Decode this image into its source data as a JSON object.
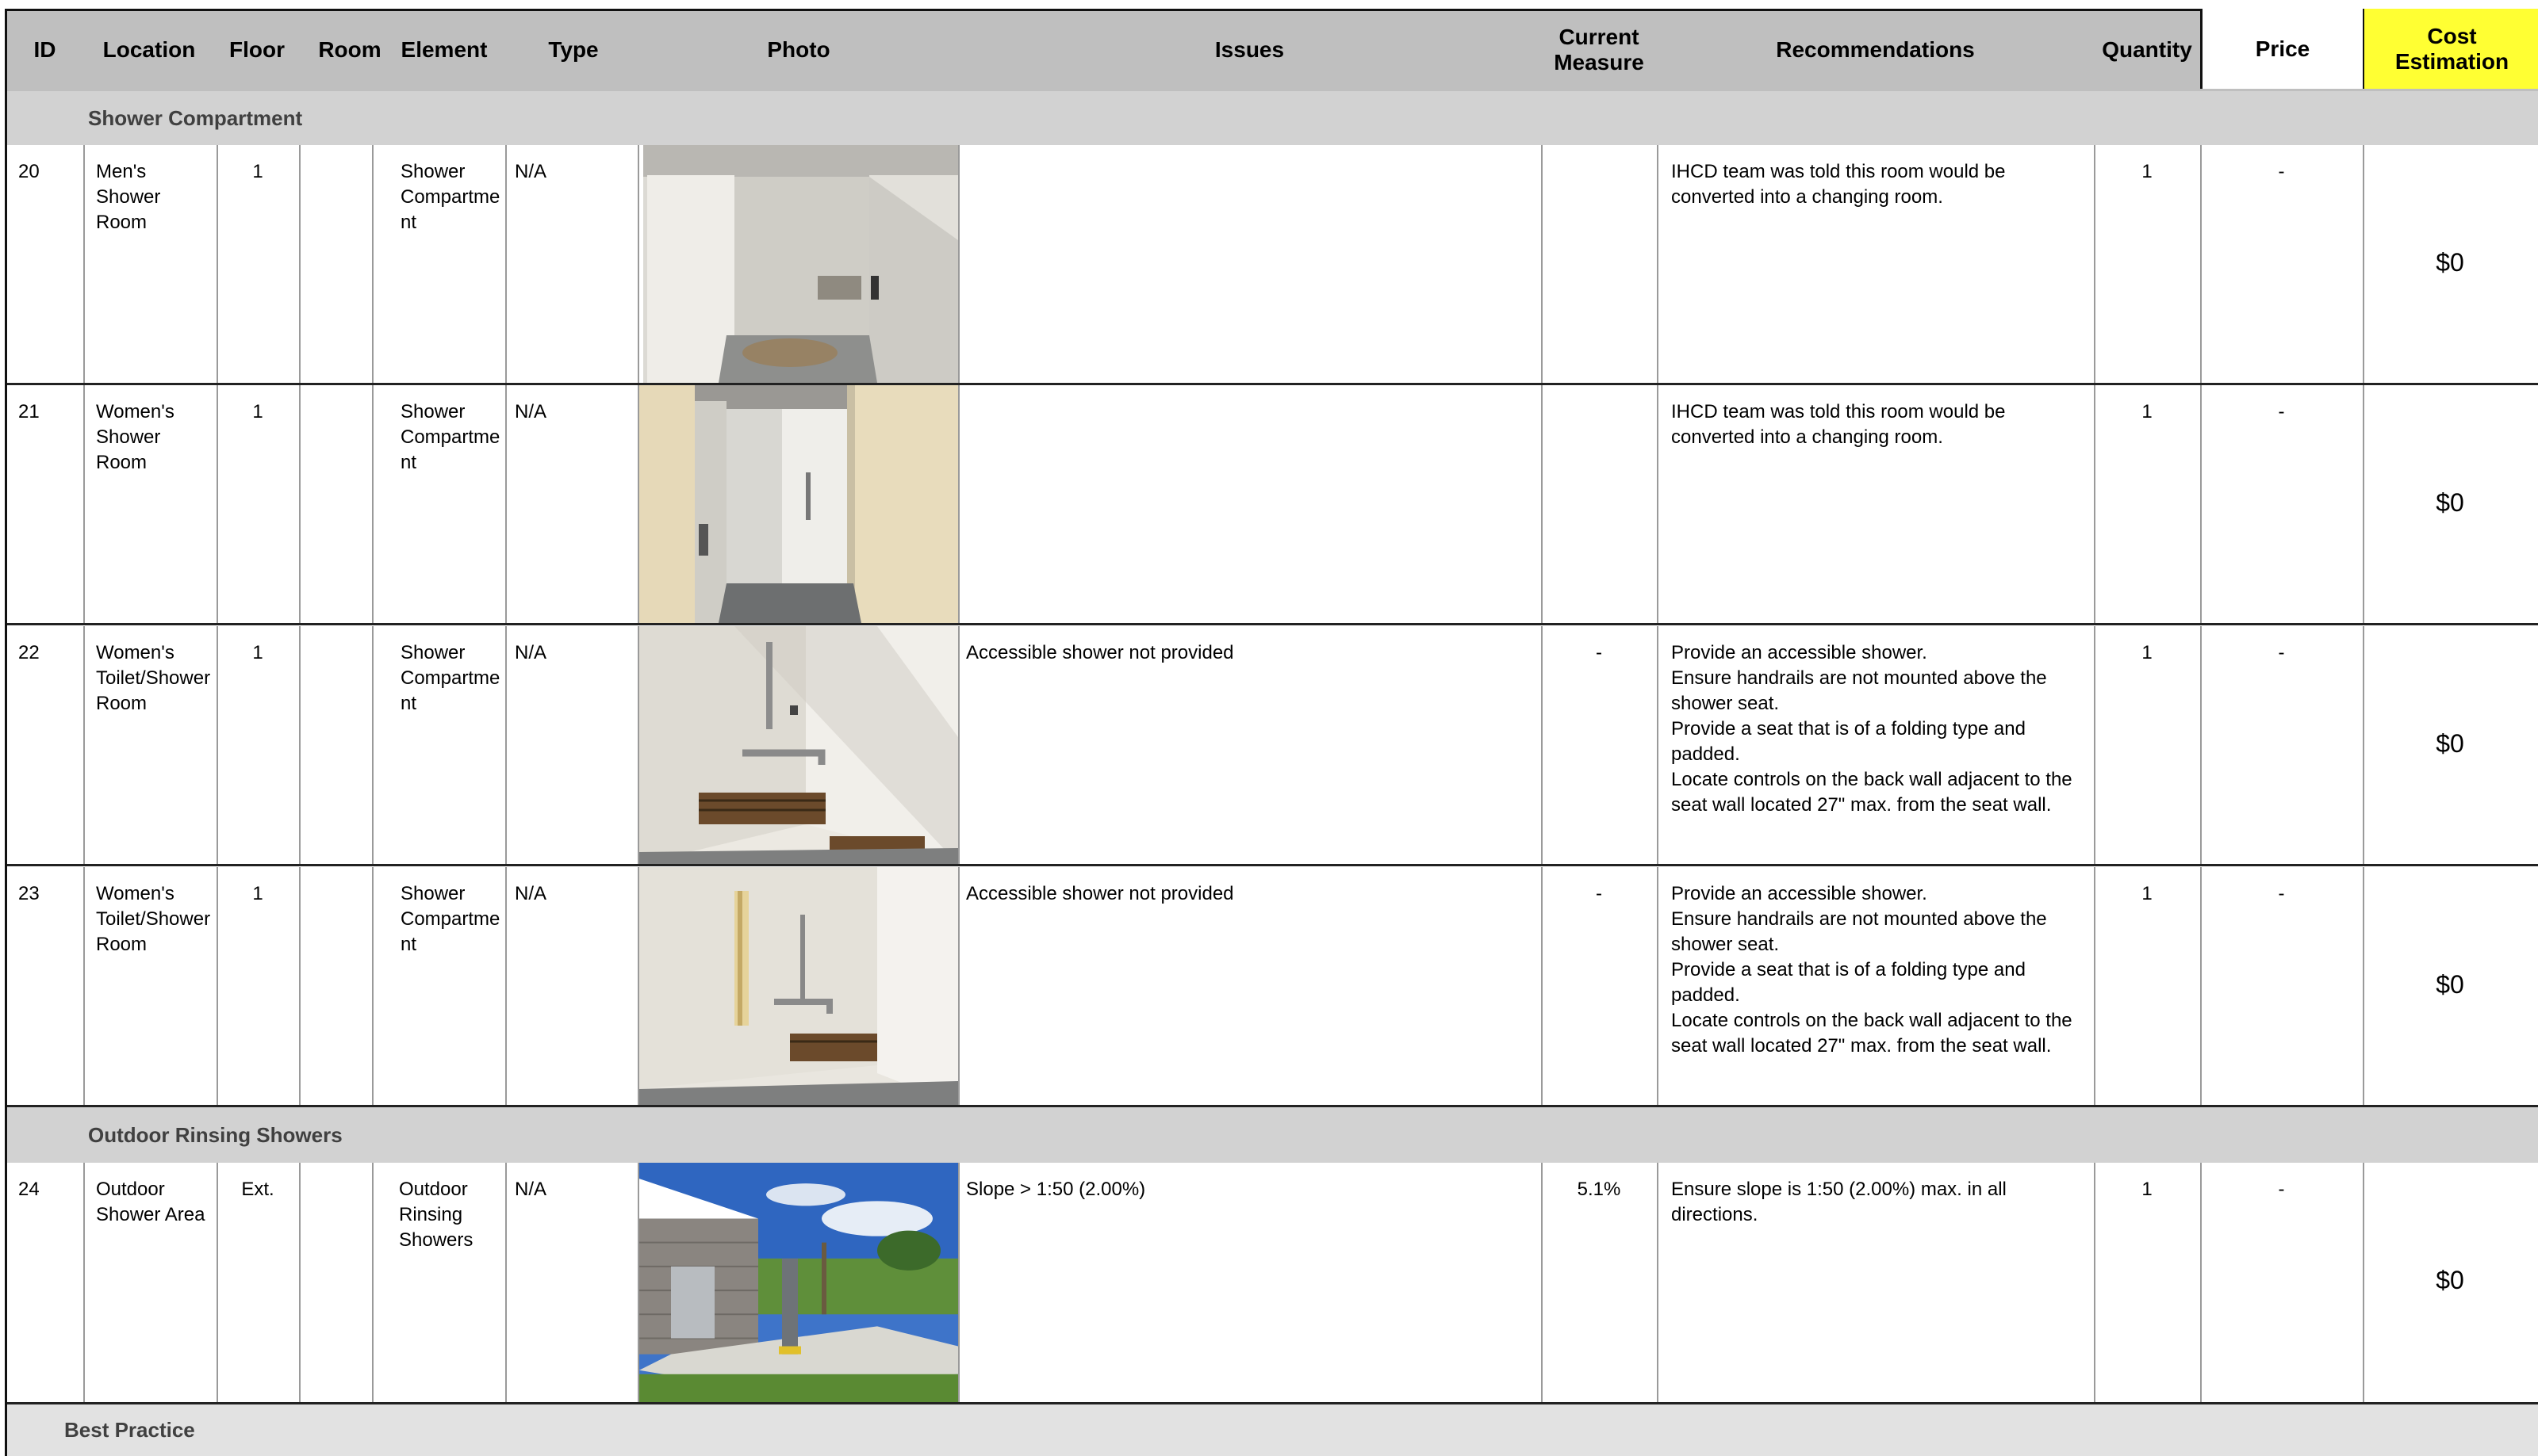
{
  "columns": {
    "id": "ID",
    "location": "Location",
    "floor": "Floor",
    "room": "Room",
    "element": "Element",
    "type": "Type",
    "photo": "Photo",
    "issues": "Issues",
    "current_measure": "Current\nMeasure",
    "recommendations": "Recommendations",
    "quantity": "Quantity",
    "price": "Price",
    "cost_estimation": "Cost\nEstimation"
  },
  "sections": {
    "shower": "Shower Compartment",
    "outdoor": "Outdoor Rinsing Showers",
    "best": "Best Practice"
  },
  "rows": [
    {
      "id": "20",
      "location": "Men's\nShower\nRoom",
      "floor": "1",
      "room": "",
      "element": "Shower\nCompartme\nnt",
      "type": "N/A",
      "issues": "",
      "measure": "",
      "recommendations": "IHCD team was told this room would be\nconverted into a changing room.",
      "quantity": "1",
      "price": "-",
      "cost": "$0",
      "photo": "shower stall with wall vent"
    },
    {
      "id": "21",
      "location": "Women's\nShower\nRoom",
      "floor": "1",
      "room": "",
      "element": "Shower\nCompartme\nnt",
      "type": "N/A",
      "issues": "",
      "measure": "",
      "recommendations": "IHCD team was told this room would be\nconverted into a changing room.",
      "quantity": "1",
      "price": "-",
      "cost": "$0",
      "photo": "shower stall between partitions"
    },
    {
      "id": "22",
      "location": "Women's\nToilet/Shower\nRoom",
      "floor": "1",
      "room": "",
      "element": "Shower\nCompartme\nnt",
      "type": "N/A",
      "issues": "Accessible shower not provided",
      "measure": "-",
      "recommendations": "Provide an accessible shower.\nEnsure handrails are not mounted above the\nshower seat.\nProvide a seat that is of a folding type and\npadded.\nLocate controls on the back wall adjacent  to the\nseat wall located 27\" max. from the seat wall.",
      "quantity": "1",
      "price": "-",
      "cost": "$0",
      "photo": "shower with wooden bench and grab bars"
    },
    {
      "id": "23",
      "location": "Women's\nToilet/Shower\nRoom",
      "floor": "1",
      "room": "",
      "element": "Shower\nCompartme\nnt",
      "type": "N/A",
      "issues": "Accessible shower not provided",
      "measure": "-",
      "recommendations": "Provide an accessible shower.\nEnsure handrails are not mounted above the\nshower seat.\nProvide a seat that is of a folding type and\npadded.\nLocate controls on the back wall adjacent  to the\nseat wall located 27\" max. from the seat wall.",
      "quantity": "1",
      "price": "-",
      "cost": "$0",
      "photo": "shower with shower head bar and bench"
    },
    {
      "id": "24",
      "location": "Outdoor\nShower Area",
      "floor": "Ext.",
      "room": "",
      "element": "Outdoor\nRinsing\nShowers",
      "type": "N/A",
      "issues": "Slope > 1:50 (2.00%)",
      "measure": "5.1%",
      "recommendations": "Ensure slope is 1:50 (2.00%) max. in all\ndirections.",
      "quantity": "1",
      "price": "-",
      "cost": "$0",
      "photo": "outdoor shower post on concrete pad"
    }
  ],
  "colors": {
    "header_bg": "#bfbfbf",
    "section_bg": "#d2d2d2",
    "cost_header": "#ffff33"
  }
}
